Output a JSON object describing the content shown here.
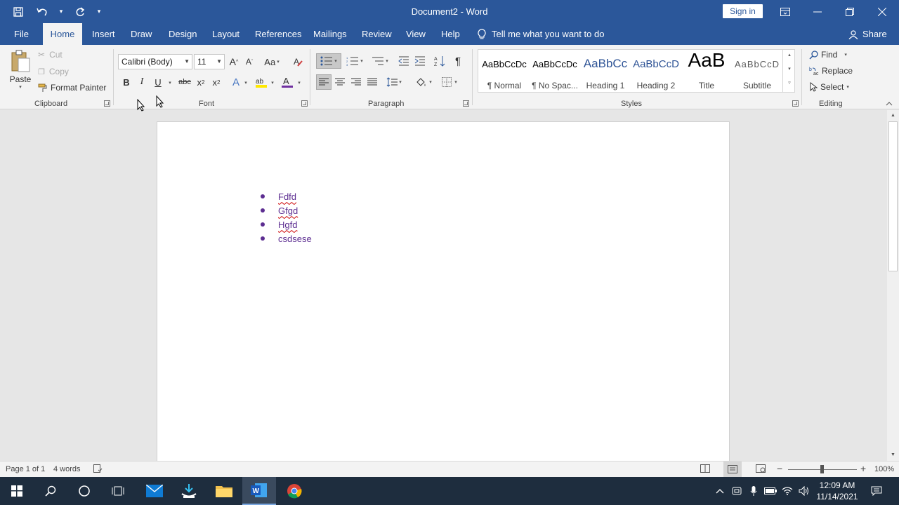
{
  "window": {
    "title": "Document2  -  Word",
    "sign_in": "Sign in"
  },
  "tabs": [
    "File",
    "Home",
    "Insert",
    "Draw",
    "Design",
    "Layout",
    "References",
    "Mailings",
    "Review",
    "View",
    "Help"
  ],
  "tell_me": "Tell me what you want to do",
  "share": "Share",
  "clipboard": {
    "paste": "Paste",
    "cut": "Cut",
    "copy": "Copy",
    "format_painter": "Format Painter",
    "label": "Clipboard"
  },
  "font": {
    "name": "Calibri (Body)",
    "size": "11",
    "label": "Font",
    "case_label": "Aa"
  },
  "paragraph": {
    "label": "Paragraph"
  },
  "styles": {
    "label": "Styles",
    "items": [
      {
        "sample": "AaBbCcDc",
        "name": "¶ Normal"
      },
      {
        "sample": "AaBbCcDc",
        "name": "¶ No Spac..."
      },
      {
        "sample": "AaBbCc",
        "name": "Heading 1"
      },
      {
        "sample": "AaBbCcD",
        "name": "Heading 2"
      },
      {
        "sample": "AaB",
        "name": "Title"
      },
      {
        "sample": "AaBbCcD",
        "name": "Subtitle"
      }
    ]
  },
  "editing": {
    "label": "Editing",
    "find": "Find",
    "replace": "Replace",
    "select": "Select"
  },
  "document": {
    "bullets": [
      "Fdfd",
      "Gfgd",
      "Hgfd",
      "csdsese"
    ]
  },
  "status": {
    "page": "Page 1 of 1",
    "words": "4 words",
    "zoom": "100%"
  },
  "taskbar": {
    "time": "12:09 AM",
    "date": "11/14/2021"
  },
  "colors": {
    "word_blue": "#2b579a",
    "bullet_text": "#5c2d91"
  }
}
